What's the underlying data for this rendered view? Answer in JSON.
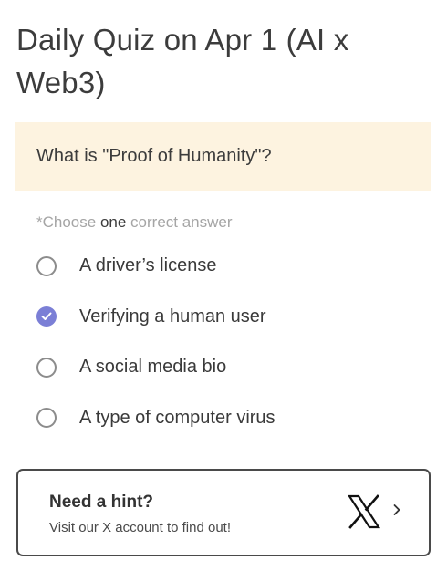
{
  "quiz": {
    "title": "Daily Quiz on Apr 1 (AI x Web3)",
    "question": "What is \"Proof of Humanity\"?",
    "instruction": {
      "prefix": "*Choose ",
      "emphasis": "one",
      "suffix": " correct answer"
    },
    "options": [
      {
        "label": "A driver’s license",
        "selected": false
      },
      {
        "label": "Verifying a human user",
        "selected": true
      },
      {
        "label": "A social media bio",
        "selected": false
      },
      {
        "label": "A type of computer virus",
        "selected": false
      }
    ]
  },
  "hint": {
    "title": "Need a hint?",
    "subtitle": "Visit our X account to find out!",
    "icon": "x-logo-icon"
  },
  "colors": {
    "accent": "#7b7fd6",
    "question_bg": "#fdf3e0"
  }
}
